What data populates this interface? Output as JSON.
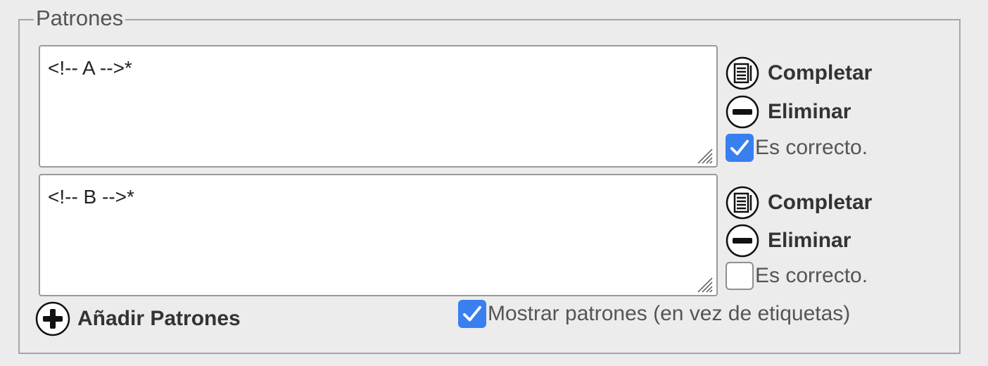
{
  "fieldset": {
    "legend": "Patrones"
  },
  "patterns": [
    {
      "value": "<!-- A -->*",
      "complete_label": "Completar",
      "remove_label": "Eliminar",
      "correct_label": "Es correcto.",
      "correct_checked": true
    },
    {
      "value": "<!-- B -->*",
      "complete_label": "Completar",
      "remove_label": "Eliminar",
      "correct_label": "Es correcto.",
      "correct_checked": false
    }
  ],
  "add_button": {
    "label": "Añadir Patrones"
  },
  "show_patterns": {
    "label": "Mostrar patrones (en vez de etiquetas)",
    "checked": true
  },
  "colors": {
    "accent": "#3a7ff0",
    "background": "#ececec"
  },
  "icons": {
    "complete": "document-list-icon",
    "remove": "minus-circle-icon",
    "add": "plus-circle-icon",
    "check": "checkmark-icon",
    "grip": "resize-grip-icon"
  }
}
